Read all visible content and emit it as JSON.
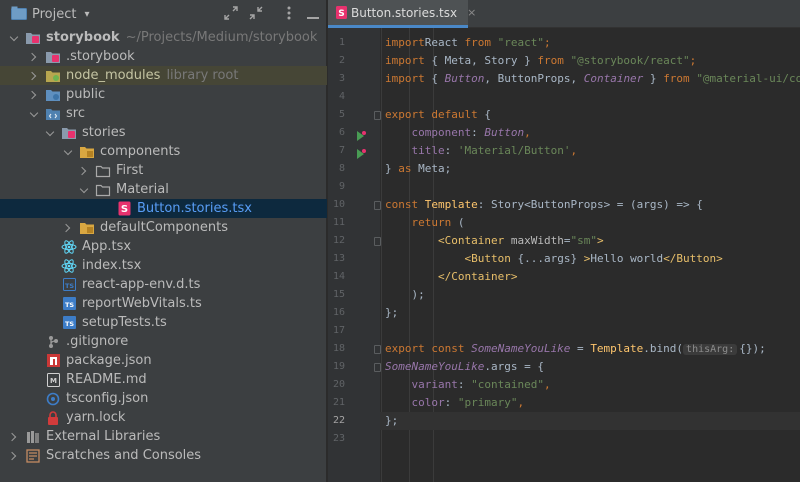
{
  "project_panel": {
    "title": "Project",
    "icons": [
      "expand-icon",
      "collapse-icon",
      "more-icon",
      "hide-icon"
    ],
    "tree": [
      {
        "label": "storybook",
        "suffix": "~/Projects/Medium/storybook",
        "icon": "module-folder-icon"
      },
      {
        "label": ".storybook",
        "icon": "folder-icon"
      },
      {
        "label": "node_modules",
        "suffix": "library root",
        "icon": "folder-icon"
      },
      {
        "label": "public",
        "icon": "folder-icon"
      },
      {
        "label": "src",
        "icon": "source-folder-icon"
      },
      {
        "label": "stories",
        "icon": "folder-icon"
      },
      {
        "label": "components",
        "icon": "folder-icon"
      },
      {
        "label": "First",
        "icon": "folder-icon"
      },
      {
        "label": "Material",
        "icon": "folder-icon"
      },
      {
        "label": "Button.stories.tsx",
        "icon": "storybook-file-icon"
      },
      {
        "label": "defaultComponents",
        "icon": "folder-icon"
      },
      {
        "label": "App.tsx",
        "icon": "react-icon"
      },
      {
        "label": "index.tsx",
        "icon": "react-icon"
      },
      {
        "label": "react-app-env.d.ts",
        "icon": "typescript-icon"
      },
      {
        "label": "reportWebVitals.ts",
        "icon": "typescript-icon"
      },
      {
        "label": "setupTests.ts",
        "icon": "typescript-icon"
      },
      {
        "label": ".gitignore",
        "icon": "gitignore-icon"
      },
      {
        "label": "package.json",
        "icon": "npm-icon"
      },
      {
        "label": "README.md",
        "icon": "markdown-icon"
      },
      {
        "label": "tsconfig.json",
        "icon": "typescript-config-icon"
      },
      {
        "label": "yarn.lock",
        "icon": "lock-icon"
      },
      {
        "label": "External Libraries",
        "icon": "library-icon"
      },
      {
        "label": "Scratches and Consoles",
        "icon": "scratches-icon"
      }
    ]
  },
  "editor": {
    "tab": {
      "label": "Button.stories.tsx",
      "close": "×"
    },
    "line_numbers": [
      "1",
      "2",
      "3",
      "4",
      "5",
      "6",
      "7",
      "8",
      "9",
      "10",
      "11",
      "12",
      "13",
      "14",
      "15",
      "16",
      "17",
      "18",
      "19",
      "20",
      "21",
      "22",
      "23"
    ],
    "current_line": "22",
    "lines": [
      [
        [
          "kw",
          "import"
        ],
        [
          "",
          "React "
        ],
        [
          "kw",
          "from "
        ],
        [
          "str",
          "\"react\""
        ],
        [
          "kw",
          ";"
        ]
      ],
      [
        [
          "kw",
          "import "
        ],
        [
          "",
          "{ Meta, Story } "
        ],
        [
          "kw",
          "from "
        ],
        [
          "str",
          "\"@storybook/react\""
        ],
        [
          "kw",
          ";"
        ]
      ],
      [
        [
          "kw",
          "import "
        ],
        [
          "",
          "{ "
        ],
        [
          "purple",
          "Button"
        ],
        [
          "",
          ", ButtonProps, "
        ],
        [
          "purple",
          "Container"
        ],
        [
          "",
          " } "
        ],
        [
          "kw",
          "from "
        ],
        [
          "str",
          "\"@material-ui/core\""
        ],
        [
          "kw",
          ";"
        ]
      ],
      [],
      [
        [
          "kw",
          "export default "
        ],
        [
          "",
          "{"
        ]
      ],
      [
        [
          "",
          "    "
        ],
        [
          "prop",
          "component"
        ],
        [
          "",
          ": "
        ],
        [
          "purple",
          "Button"
        ],
        [
          "kw",
          ","
        ]
      ],
      [
        [
          "",
          "    "
        ],
        [
          "prop",
          "title"
        ],
        [
          "",
          ": "
        ],
        [
          "str",
          "'Material/Button'"
        ],
        [
          "kw",
          ","
        ]
      ],
      [
        [
          "",
          "} "
        ],
        [
          "kw",
          "as "
        ],
        [
          "",
          "Meta;"
        ]
      ],
      [],
      [
        [
          "kw",
          "const "
        ],
        [
          "fn",
          "Template"
        ],
        [
          "",
          ": Story<ButtonProps> = (args) => {"
        ]
      ],
      [
        [
          "",
          "    "
        ],
        [
          "kw",
          "return "
        ],
        [
          "",
          "("
        ]
      ],
      [
        [
          "",
          "        "
        ],
        [
          "tag",
          "<Container "
        ],
        [
          "attr",
          "maxWidth"
        ],
        [
          "",
          "="
        ],
        [
          "str",
          "\"sm\""
        ],
        [
          "tag",
          ">"
        ]
      ],
      [
        [
          "",
          "            "
        ],
        [
          "tag",
          "<Button "
        ],
        [
          "",
          "{...args} "
        ],
        [
          "tag",
          ">"
        ],
        [
          "",
          "Hello world"
        ],
        [
          "tag",
          "</Button>"
        ]
      ],
      [
        [
          "",
          "        "
        ],
        [
          "tag",
          "</Container>"
        ]
      ],
      [
        [
          "",
          "    "
        ],
        [
          "",
          ");"
        ]
      ],
      [
        [
          "",
          "};"
        ]
      ],
      [],
      [
        [
          "kw",
          "export const "
        ],
        [
          "purple",
          "SomeNameYouLike"
        ],
        [
          "",
          " = "
        ],
        [
          "fn",
          "Template"
        ],
        [
          "",
          ".bind("
        ],
        [
          "hint",
          "thisArg:"
        ],
        [
          "",
          "{});"
        ]
      ],
      [
        [
          "purple",
          "SomeNameYouLike"
        ],
        [
          "",
          ".args = {"
        ]
      ],
      [
        [
          "",
          "    "
        ],
        [
          "prop",
          "variant"
        ],
        [
          "",
          ": "
        ],
        [
          "str",
          "\"contained\""
        ],
        [
          "kw",
          ","
        ]
      ],
      [
        [
          "",
          "    "
        ],
        [
          "prop",
          "color"
        ],
        [
          "",
          ": "
        ],
        [
          "str",
          "\"primary\""
        ],
        [
          "kw",
          ","
        ]
      ],
      [
        [
          "",
          "};"
        ]
      ],
      []
    ]
  }
}
